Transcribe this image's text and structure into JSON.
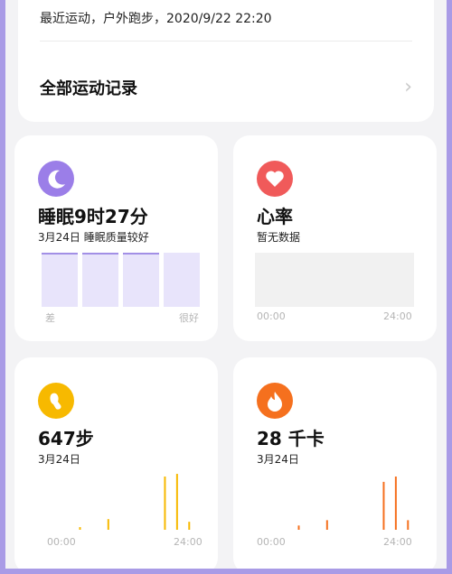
{
  "recent": {
    "text": "最近运动，户外跑步，2020/9/22 22:20"
  },
  "all_records": {
    "label": "全部运动记录",
    "chevron": "›"
  },
  "sleep": {
    "value": "睡眠9时27分",
    "subtitle": "3月24日 睡眠质量较好",
    "left_label": "差",
    "right_label": "很好",
    "color": "#9b7ee8"
  },
  "heart": {
    "title": "心率",
    "subtitle": "暂无数据",
    "start": "00:00",
    "end": "24:00",
    "color": "#f05a5a"
  },
  "steps": {
    "value": "647步",
    "subtitle": "3月24日",
    "start": "00:00",
    "end": "24:00",
    "color": "#f7b900",
    "hours": [
      0,
      0,
      0,
      0,
      0,
      0,
      0,
      0,
      0,
      0.05,
      0,
      0,
      0,
      0,
      0,
      0,
      0.2,
      0,
      0,
      0,
      0,
      0,
      0,
      0,
      0,
      0,
      0,
      0,
      0,
      0,
      1,
      0,
      0,
      1.05,
      0,
      0,
      0.15,
      0
    ]
  },
  "kcal": {
    "value": "28 千卡",
    "subtitle": "3月24日",
    "start": "00:00",
    "end": "24:00",
    "color": "#f5701e",
    "hours": [
      0,
      0,
      0,
      0,
      0,
      0,
      0,
      0,
      0,
      0.08,
      0,
      0,
      0,
      0,
      0,
      0,
      0.18,
      0,
      0,
      0,
      0,
      0,
      0,
      0,
      0,
      0,
      0,
      0,
      0,
      0,
      0.9,
      0,
      0,
      1.0,
      0,
      0,
      0.18,
      0
    ]
  }
}
